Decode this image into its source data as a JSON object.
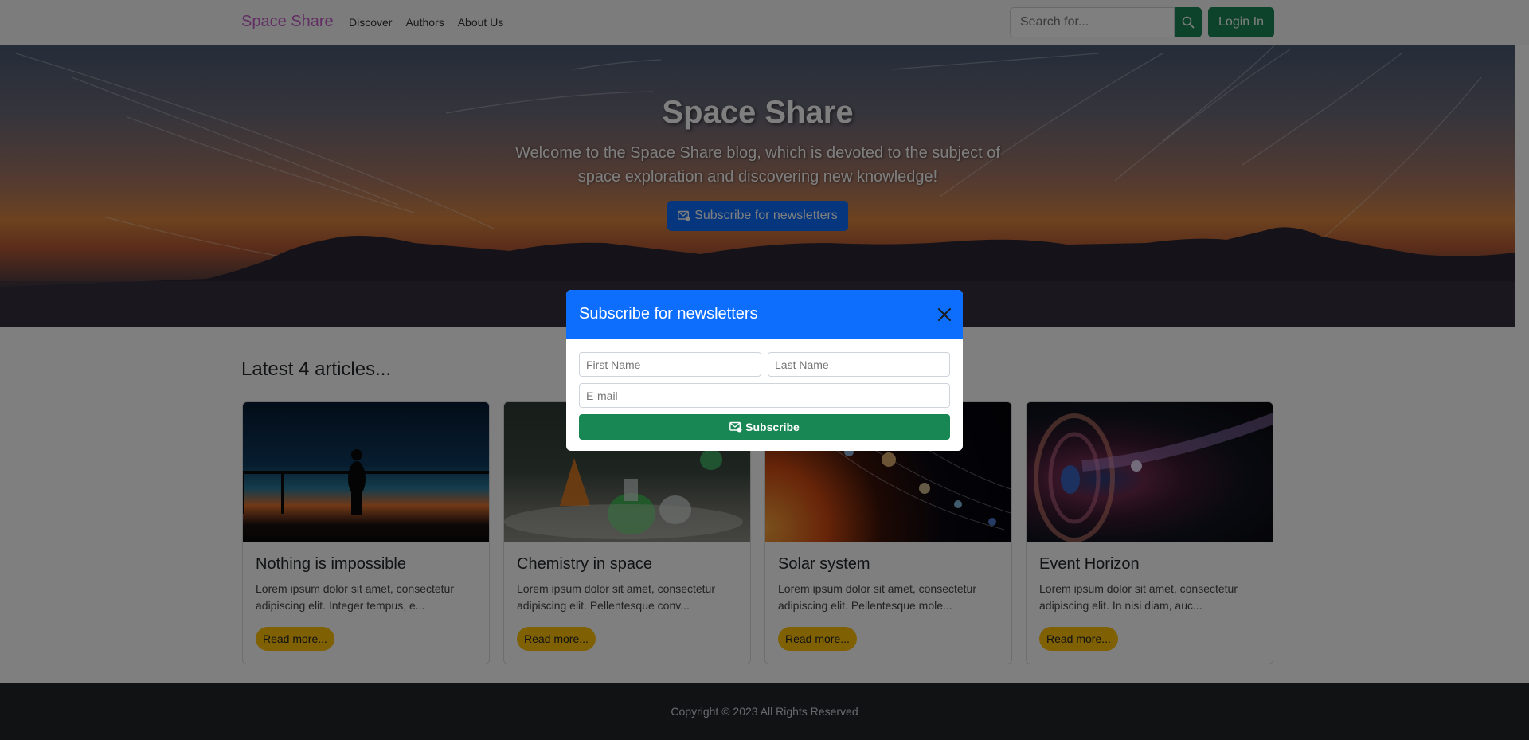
{
  "navbar": {
    "brand": "Space Share",
    "links": [
      "Discover",
      "Authors",
      "About Us"
    ],
    "search_placeholder": "Search for...",
    "login_label": "Login In"
  },
  "hero": {
    "title": "Space Share",
    "subtitle": "Welcome to the Space Share blog, which is devoted to the subject of space exploration and discovering new knowledge!",
    "button_label": "Subscribe for newsletters"
  },
  "articles": {
    "heading": "Latest 4 articles...",
    "items": [
      {
        "title": "Nothing is impossible",
        "excerpt": "Lorem ipsum dolor sit amet, consectetur adipiscing elit. Integer tempus, e...",
        "button": "Read more..."
      },
      {
        "title": "Chemistry in space",
        "excerpt": "Lorem ipsum dolor sit amet, consectetur adipiscing elit. Pellentesque conv...",
        "button": "Read more..."
      },
      {
        "title": "Solar system",
        "excerpt": "Lorem ipsum dolor sit amet, consectetur adipiscing elit. Pellentesque mole...",
        "button": "Read more..."
      },
      {
        "title": "Event Horizon",
        "excerpt": "Lorem ipsum dolor sit amet, consectetur adipiscing elit. In nisi diam, auc...",
        "button": "Read more..."
      }
    ]
  },
  "footer": {
    "copyright": "Copyright © 2023 All Rights Reserved"
  },
  "modal": {
    "title": "Subscribe for newsletters",
    "first_name_placeholder": "First Name",
    "last_name_placeholder": "Last Name",
    "email_placeholder": "E-mail",
    "submit_label": "Subscribe"
  },
  "colors": {
    "brand": "#c45dc6",
    "primary": "#0d6efd",
    "success": "#198754",
    "warning": "#ffc107",
    "footer_bg": "#212529"
  },
  "icons": [
    "search-icon",
    "envelope-icon",
    "close-icon"
  ]
}
